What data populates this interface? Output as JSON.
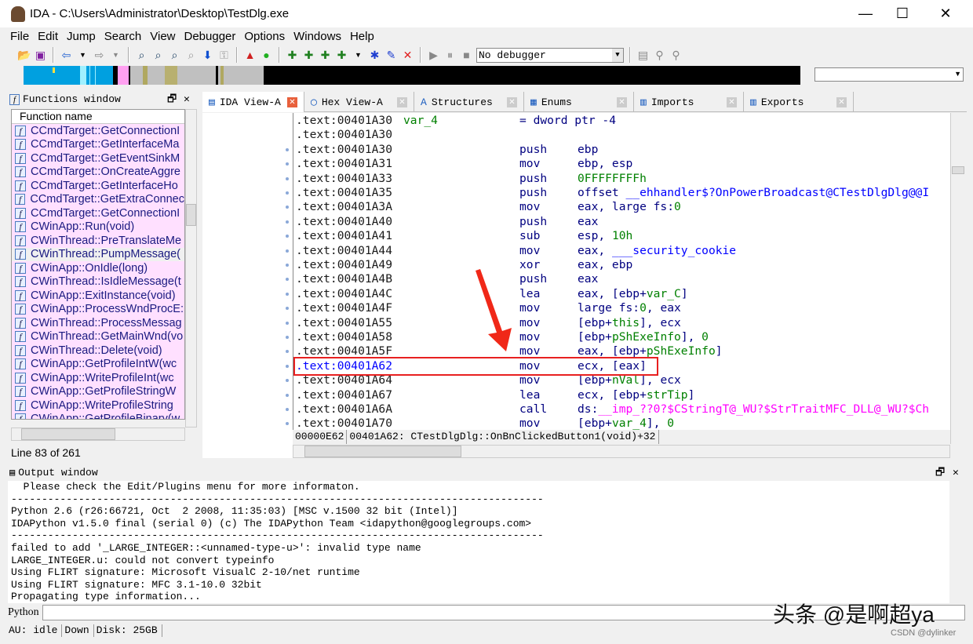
{
  "window": {
    "title": "IDA - C:\\Users\\Administrator\\Desktop\\TestDlg.exe",
    "minimize": "—",
    "maximize": "☐",
    "close": "✕"
  },
  "menu": [
    "File",
    "Edit",
    "Jump",
    "Search",
    "View",
    "Debugger",
    "Options",
    "Windows",
    "Help"
  ],
  "toolbar": {
    "debugger_select": "No debugger"
  },
  "functions_window": {
    "title": "Functions window",
    "column": "Function name",
    "line_info": "Line 83 of 261",
    "items": [
      "CCmdTarget::GetConnectionI",
      "CCmdTarget::GetInterfaceMa",
      "CCmdTarget::GetEventSinkM",
      "CCmdTarget::OnCreateAggre",
      "CCmdTarget::GetInterfaceHo",
      "CCmdTarget::GetExtraConnec",
      "CCmdTarget::GetConnectionI",
      "CWinApp::Run(void)",
      "CWinThread::PreTranslateMe",
      "CWinThread::PumpMessage(",
      "CWinApp::OnIdle(long)",
      "CWinThread::IsIdleMessage(t",
      "CWinApp::ExitInstance(void)",
      "CWinApp::ProcessWndProcE:",
      "CWinThread::ProcessMessag",
      "CWinThread::GetMainWnd(vo",
      "CWinThread::Delete(void)",
      "CWinApp::GetProfileIntW(wc",
      "CWinApp::WriteProfileInt(wc",
      "CWinApp::GetProfileStringW",
      "CWinApp::WriteProfileString",
      "CWinApp::GetProfileBinary(w"
    ],
    "selected_index": 9
  },
  "tabs": [
    {
      "label": "IDA View-A",
      "active": true
    },
    {
      "label": "Hex View-A"
    },
    {
      "label": "Structures"
    },
    {
      "label": "Enums"
    },
    {
      "label": "Imports"
    },
    {
      "label": "Exports"
    }
  ],
  "colors": {
    "reg": "#000080",
    "var": "#008000",
    "name": "#0000ff",
    "import": "#ff00ff",
    "highlight_box": "#e82020"
  },
  "code": [
    {
      "addr": ".text:00401A30",
      "label": "var_4",
      "mn": "= dword ptr -4",
      "op": []
    },
    {
      "addr": ".text:00401A30",
      "mn": "",
      "op": []
    },
    {
      "addr": ".text:00401A30",
      "mn": "push",
      "op": [
        [
          "ebp",
          "reg"
        ]
      ]
    },
    {
      "addr": ".text:00401A31",
      "mn": "mov",
      "op": [
        [
          "ebp, esp",
          "reg"
        ]
      ]
    },
    {
      "addr": ".text:00401A33",
      "mn": "push",
      "op": [
        [
          "0FFFFFFFFh",
          "var"
        ]
      ]
    },
    {
      "addr": ".text:00401A35",
      "mn": "push",
      "op": [
        [
          "offset ",
          "reg"
        ],
        [
          "__ehhandler$?OnPowerBroadcast@CTestDlgDlg@@I",
          "name"
        ]
      ]
    },
    {
      "addr": ".text:00401A3A",
      "mn": "mov",
      "op": [
        [
          "eax, large fs:",
          "reg"
        ],
        [
          "0",
          "var"
        ]
      ]
    },
    {
      "addr": ".text:00401A40",
      "mn": "push",
      "op": [
        [
          "eax",
          "reg"
        ]
      ]
    },
    {
      "addr": ".text:00401A41",
      "mn": "sub",
      "op": [
        [
          "esp, ",
          "reg"
        ],
        [
          "10h",
          "var"
        ]
      ]
    },
    {
      "addr": ".text:00401A44",
      "mn": "mov",
      "op": [
        [
          "eax, ",
          "reg"
        ],
        [
          "___security_cookie",
          "name"
        ]
      ]
    },
    {
      "addr": ".text:00401A49",
      "mn": "xor",
      "op": [
        [
          "eax, ebp",
          "reg"
        ]
      ]
    },
    {
      "addr": ".text:00401A4B",
      "mn": "push",
      "op": [
        [
          "eax",
          "reg"
        ]
      ]
    },
    {
      "addr": ".text:00401A4C",
      "mn": "lea",
      "op": [
        [
          "eax, [ebp+",
          "reg"
        ],
        [
          "var_C",
          "var"
        ],
        [
          "]",
          "reg"
        ]
      ]
    },
    {
      "addr": ".text:00401A4F",
      "mn": "mov",
      "op": [
        [
          "large fs:",
          "reg"
        ],
        [
          "0",
          "var"
        ],
        [
          ", eax",
          "reg"
        ]
      ]
    },
    {
      "addr": ".text:00401A55",
      "mn": "mov",
      "op": [
        [
          "[ebp+",
          "reg"
        ],
        [
          "this",
          "var"
        ],
        [
          "], ecx",
          "reg"
        ]
      ]
    },
    {
      "addr": ".text:00401A58",
      "mn": "mov",
      "op": [
        [
          "[ebp+",
          "reg"
        ],
        [
          "pShExeInfo",
          "var"
        ],
        [
          "], ",
          "reg"
        ],
        [
          "0",
          "var"
        ]
      ]
    },
    {
      "addr": ".text:00401A5F",
      "mn": "mov",
      "op": [
        [
          "eax, [ebp+",
          "reg"
        ],
        [
          "pShExeInfo",
          "var"
        ],
        [
          "]",
          "reg"
        ]
      ]
    },
    {
      "addr": ".text:00401A62",
      "mn": "mov",
      "op": [
        [
          "ecx, [eax]",
          "reg"
        ]
      ],
      "highlight": true
    },
    {
      "addr": ".text:00401A64",
      "mn": "mov",
      "op": [
        [
          "[ebp+",
          "reg"
        ],
        [
          "nVal",
          "var"
        ],
        [
          "], ecx",
          "reg"
        ]
      ]
    },
    {
      "addr": ".text:00401A67",
      "mn": "lea",
      "op": [
        [
          "ecx, [ebp+",
          "reg"
        ],
        [
          "strTip",
          "var"
        ],
        [
          "]",
          "reg"
        ]
      ]
    },
    {
      "addr": ".text:00401A6A",
      "mn": "call",
      "op": [
        [
          "ds:",
          "reg"
        ],
        [
          "__imp_??0?$CStringT@_WU?$StrTraitMFC_DLL@_WU?$Ch",
          "import"
        ]
      ]
    },
    {
      "addr": ".text:00401A70",
      "mn": "mov",
      "op": [
        [
          "[ebp+",
          "reg"
        ],
        [
          "var_4",
          "var"
        ],
        [
          "], ",
          "reg"
        ],
        [
          "0",
          "var"
        ]
      ]
    }
  ],
  "code_status": {
    "offset": "00000E62",
    "location": "00401A62: CTestDlgDlg::OnBnClickedButton1(void)+32"
  },
  "output_window": {
    "title": "Output window",
    "lines": [
      "  Please check the Edit/Plugins menu for more informaton.",
      "---------------------------------------------------------------------------------------",
      "Python 2.6 (r26:66721, Oct  2 2008, 11:35:03) [MSC v.1500 32 bit (Intel)]",
      "IDAPython v1.5.0 final (serial 0) (c) The IDAPython Team <idapython@googlegroups.com>",
      "---------------------------------------------------------------------------------------",
      "failed to add '_LARGE_INTEGER::<unnamed-type-u>': invalid type name",
      "LARGE_INTEGER.u: could not convert typeinfo",
      "Using FLIRT signature: Microsoft VisualC 2-10/net runtime",
      "Using FLIRT signature: MFC 3.1-10.0 32bit",
      "Propagating type information..."
    ],
    "input_label": "Python",
    "input_value": ""
  },
  "statusbar": [
    "AU:  idle",
    "Down",
    "Disk: 25GB"
  ],
  "watermark": {
    "main": "头条 @是啊超ya",
    "csdn": "CSDN @dylinker"
  }
}
